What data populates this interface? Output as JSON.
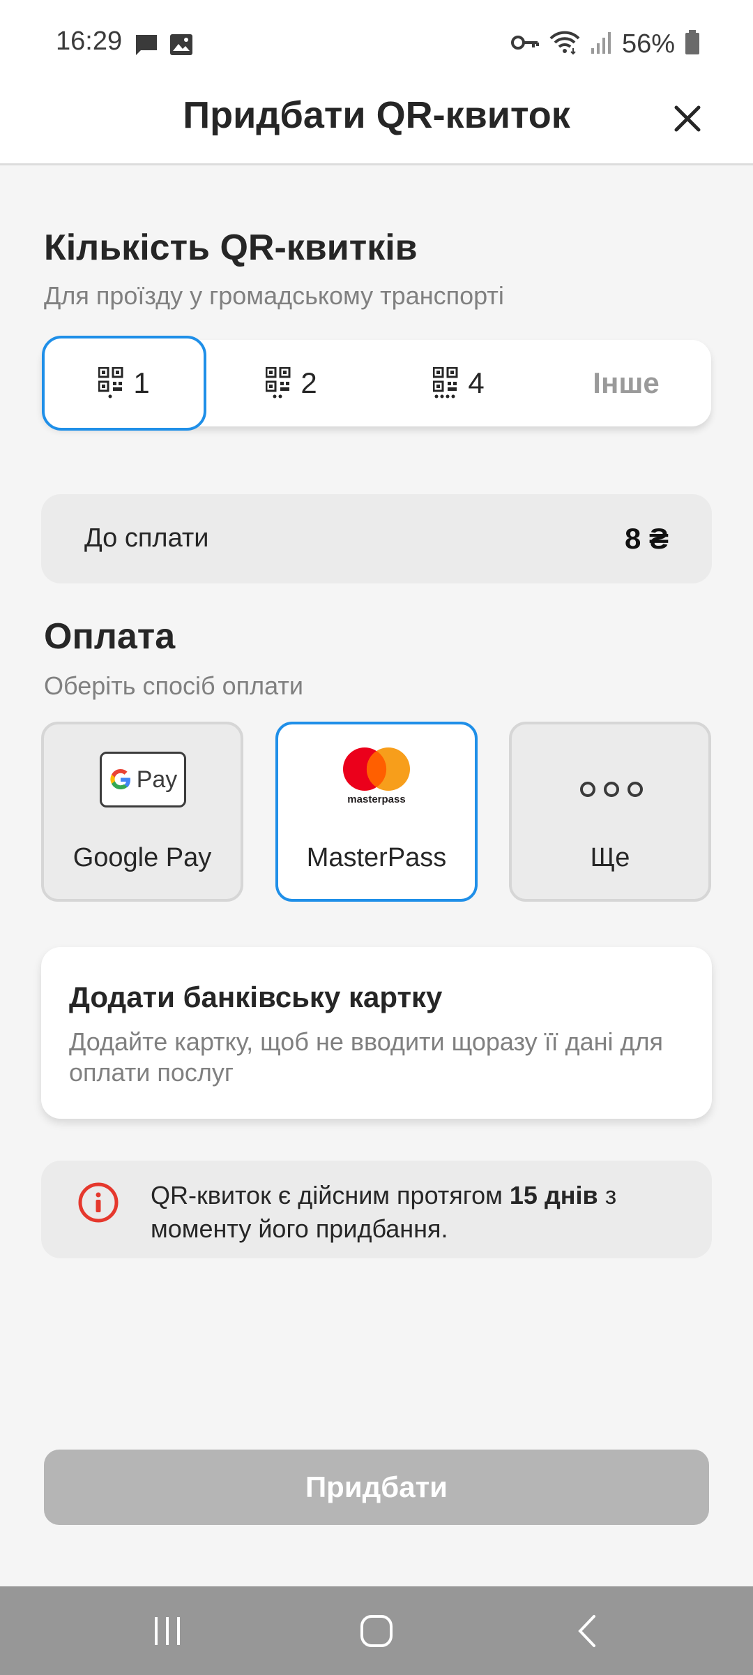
{
  "status_bar": {
    "time": "16:29",
    "battery": "56%",
    "icons": [
      "message-icon",
      "image-icon",
      "vpn-key-icon",
      "wifi-icon",
      "signal-icon",
      "battery-icon"
    ]
  },
  "header": {
    "title": "Придбати QR-квиток",
    "close_icon": "close-icon"
  },
  "quantity": {
    "title": "Кількість QR-квитків",
    "subtitle": "Для проїзду у громадському транспорті",
    "options": [
      {
        "label": "1",
        "icon": "qr-icon",
        "selected": true
      },
      {
        "label": "2",
        "icon": "qr-icon",
        "selected": false
      },
      {
        "label": "4",
        "icon": "qr-icon",
        "selected": false
      },
      {
        "label": "Інше",
        "selected": false
      }
    ]
  },
  "total": {
    "label": "До сплати",
    "value": "8 ₴"
  },
  "payment": {
    "title": "Оплата",
    "subtitle": "Оберіть спосіб оплати",
    "methods": [
      {
        "label": "Google Pay",
        "logo_text": "Pay",
        "selected": false
      },
      {
        "label": "MasterPass",
        "logo_text": "masterpass",
        "selected": true
      },
      {
        "label": "Ще",
        "selected": false
      }
    ]
  },
  "add_card": {
    "title": "Додати банківську картку",
    "description": "Додайте картку, щоб не вводити щоразу її дані для оплати послуг"
  },
  "info": {
    "text_before": "QR-квиток є дійсним протягом ",
    "text_bold": "15 днів",
    "text_after": " з моменту його придбання."
  },
  "buy_button": {
    "label": "Придбати"
  },
  "colors": {
    "accent": "#1f8fe8",
    "background": "#f5f5f5",
    "disabled_button": "#b5b5b5",
    "info_red": "#e5382d",
    "mastercard_red": "#eb001b",
    "mastercard_orange": "#f79e1b"
  },
  "nav_bar": {
    "items": [
      "recents-icon",
      "home-icon",
      "back-icon"
    ]
  }
}
